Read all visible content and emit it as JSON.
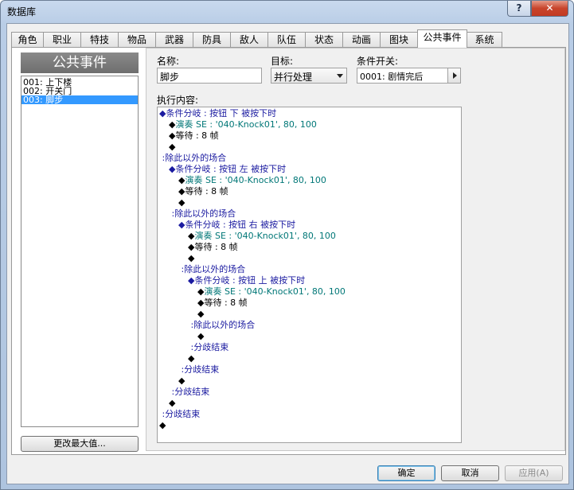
{
  "window": {
    "title": "数据库",
    "help_label": "?",
    "close_label": "✕"
  },
  "tabs": [
    {
      "label": "角色"
    },
    {
      "label": "职业"
    },
    {
      "label": "特技"
    },
    {
      "label": "物品"
    },
    {
      "label": "武器"
    },
    {
      "label": "防具"
    },
    {
      "label": "敌人"
    },
    {
      "label": "队伍"
    },
    {
      "label": "状态"
    },
    {
      "label": "动画"
    },
    {
      "label": "图块"
    },
    {
      "label": "公共事件"
    },
    {
      "label": "系统"
    }
  ],
  "active_tab": "公共事件",
  "event_list": {
    "header": "公共事件",
    "items": [
      {
        "label": "001: 上下楼"
      },
      {
        "label": "002: 开关门"
      },
      {
        "label": "003: 脚步"
      }
    ],
    "selected_index": 2,
    "change_max_label": "更改最大值..."
  },
  "detail": {
    "name_label": "名称:",
    "name_value": "脚步",
    "target_label": "目标:",
    "target_value": "并行处理",
    "switch_label": "条件开关:",
    "switch_value": "0001: 剧情完后",
    "content_label": "执行内容:"
  },
  "commands": [
    {
      "indent": 0,
      "text": "◆条件分岐 : 按钮 下 被按下时",
      "style": "blue"
    },
    {
      "indent": 1,
      "text": "◆",
      "extra": "演奏 SE : '040-Knock01', 80, 100",
      "style": "teal"
    },
    {
      "indent": 1,
      "text": "◆等待 : 8 帧",
      "style": "plain"
    },
    {
      "indent": 1,
      "text": "◆",
      "style": "plain"
    },
    {
      "indent": 0,
      "text": " :除此以外的场合",
      "style": "blue"
    },
    {
      "indent": 1,
      "text": "◆条件分岐 : 按钮 左 被按下时",
      "style": "blue"
    },
    {
      "indent": 2,
      "text": "◆",
      "extra": "演奏 SE : '040-Knock01', 80, 100",
      "style": "teal"
    },
    {
      "indent": 2,
      "text": "◆等待 : 8 帧",
      "style": "plain"
    },
    {
      "indent": 2,
      "text": "◆",
      "style": "plain"
    },
    {
      "indent": 1,
      "text": " :除此以外的场合",
      "style": "blue"
    },
    {
      "indent": 2,
      "text": "◆条件分岐 : 按钮 右 被按下时",
      "style": "blue"
    },
    {
      "indent": 3,
      "text": "◆",
      "extra": "演奏 SE : '040-Knock01', 80, 100",
      "style": "teal"
    },
    {
      "indent": 3,
      "text": "◆等待 : 8 帧",
      "style": "plain"
    },
    {
      "indent": 3,
      "text": "◆",
      "style": "plain"
    },
    {
      "indent": 2,
      "text": " :除此以外的场合",
      "style": "blue"
    },
    {
      "indent": 3,
      "text": "◆条件分岐 : 按钮 上 被按下时",
      "style": "blue"
    },
    {
      "indent": 4,
      "text": "◆",
      "extra": "演奏 SE : '040-Knock01', 80, 100",
      "style": "teal"
    },
    {
      "indent": 4,
      "text": "◆等待 : 8 帧",
      "style": "plain"
    },
    {
      "indent": 4,
      "text": "◆",
      "style": "plain"
    },
    {
      "indent": 3,
      "text": " :除此以外的场合",
      "style": "blue"
    },
    {
      "indent": 4,
      "text": "◆",
      "style": "plain"
    },
    {
      "indent": 3,
      "text": " :分歧结束",
      "style": "blue"
    },
    {
      "indent": 3,
      "text": "◆",
      "style": "plain"
    },
    {
      "indent": 2,
      "text": " :分歧结束",
      "style": "blue"
    },
    {
      "indent": 2,
      "text": "◆",
      "style": "plain"
    },
    {
      "indent": 1,
      "text": " :分歧结束",
      "style": "blue"
    },
    {
      "indent": 1,
      "text": "◆",
      "style": "plain"
    },
    {
      "indent": 0,
      "text": " :分歧结束",
      "style": "blue"
    },
    {
      "indent": 0,
      "text": "◆",
      "style": "plain"
    }
  ],
  "buttons": {
    "ok": "确定",
    "cancel": "取消",
    "apply": "应用(A)"
  }
}
